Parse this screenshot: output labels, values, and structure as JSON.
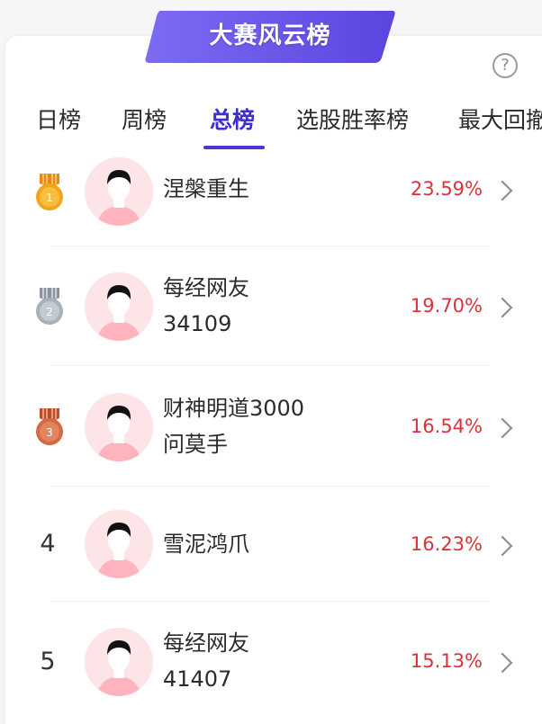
{
  "banner": {
    "title": "大赛风云榜"
  },
  "help": {
    "icon": "help-circle-icon",
    "glyph": "?"
  },
  "tabs": [
    {
      "label": "日榜",
      "active": false
    },
    {
      "label": "周榜",
      "active": false
    },
    {
      "label": "总榜",
      "active": true
    },
    {
      "label": "选股胜率榜",
      "active": false
    },
    {
      "label": "最大回撤",
      "active": false
    }
  ],
  "ranking": [
    {
      "rank": "1",
      "medal": "gold",
      "name_line1": "涅槃重生",
      "name_line2": "",
      "pct": "23.59%"
    },
    {
      "rank": "2",
      "medal": "silver",
      "name_line1": "每经网友",
      "name_line2": "34109",
      "pct": "19.70%"
    },
    {
      "rank": "3",
      "medal": "bronze",
      "name_line1": "财神明道3000",
      "name_line2": "问莫手",
      "pct": "16.54%"
    },
    {
      "rank": "4",
      "medal": "",
      "name_line1": "雪泥鸿爪",
      "name_line2": "",
      "pct": "16.23%"
    },
    {
      "rank": "5",
      "medal": "",
      "name_line1": "每经网友",
      "name_line2": "41407",
      "pct": "15.13%"
    }
  ],
  "colors": {
    "accent": "#4a37d6",
    "percent": "#d8323b",
    "gold": "#f2a51c",
    "silver": "#a9b0bb",
    "bronze": "#d26a45",
    "avatar_bg": "#fde4e7"
  }
}
